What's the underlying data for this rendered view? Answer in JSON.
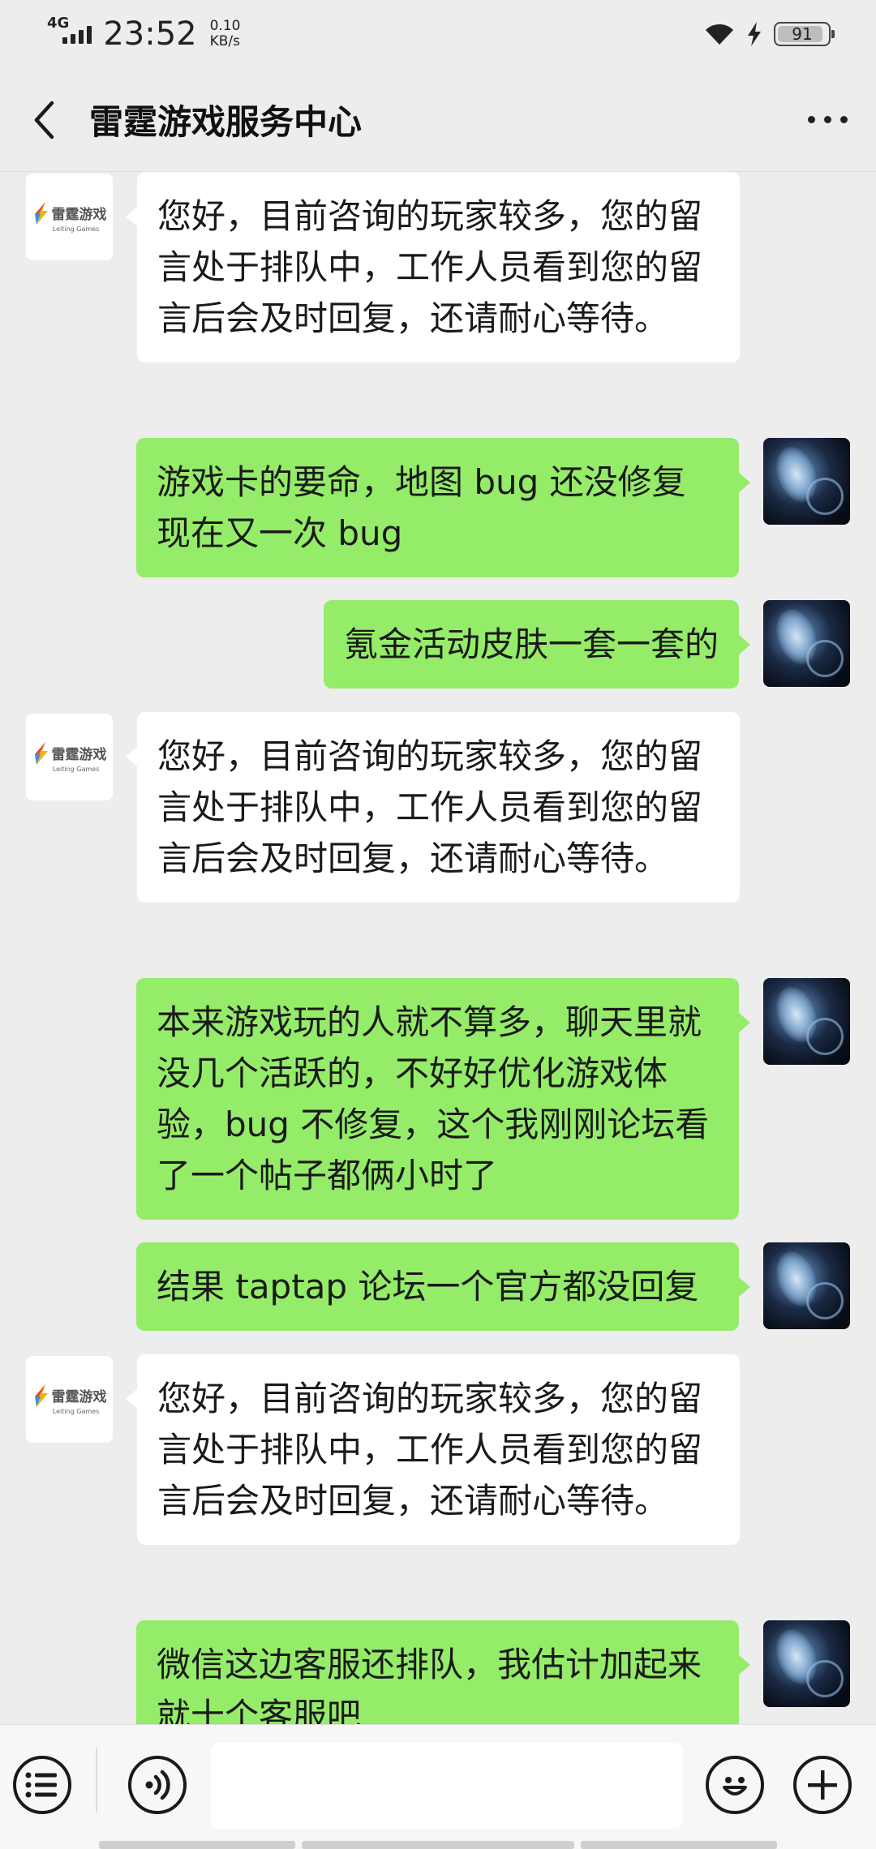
{
  "status_bar": {
    "network": "4G",
    "time": "23:52",
    "speed_value": "0.10",
    "speed_unit": "KB/s",
    "battery": "91",
    "battery_level": 0.91,
    "icons": [
      "signal-icon",
      "wifi-icon",
      "charging-icon",
      "battery-icon"
    ]
  },
  "header": {
    "title": "雷霆游戏服务中心",
    "back_icon": "chevron-left-icon",
    "more_icon": "more-icon"
  },
  "official_avatar": {
    "logo_text_zh": "雷霆游戏",
    "logo_text_en": "Leiting Games"
  },
  "messages": [
    {
      "from": "official",
      "text": "您好，目前咨询的玩家较多，您的留言处于排队中，工作人员看到您的留言后会及时回复，还请耐心等待。"
    },
    {
      "from": "me",
      "text": "游戏卡的要命，地图 bug 还没修复现在又一次 bug"
    },
    {
      "from": "me",
      "text": "氪金活动皮肤一套一套的"
    },
    {
      "from": "official",
      "text": "您好，目前咨询的玩家较多，您的留言处于排队中，工作人员看到您的留言后会及时回复，还请耐心等待。"
    },
    {
      "from": "me",
      "text": "本来游戏玩的人就不算多，聊天里就没几个活跃的，不好好优化游戏体验，bug 不修复，这个我刚刚论坛看了一个帖子都俩小时了"
    },
    {
      "from": "me",
      "text": "结果 taptap 论坛一个官方都没回复"
    },
    {
      "from": "official",
      "text": "您好，目前咨询的玩家较多，您的留言处于排队中，工作人员看到您的留言后会及时回复，还请耐心等待。"
    },
    {
      "from": "me",
      "text": "微信这边客服还排队，我估计加起来就十个客服吧"
    }
  ],
  "bottom_bar": {
    "menu_icon": "menu-list-icon",
    "voice_icon": "voice-icon",
    "input_value": "",
    "emoji_icon": "emoji-icon",
    "plus_icon": "plus-icon"
  },
  "colors": {
    "background": "#ededed",
    "bubble_me": "#95ec69",
    "bubble_official": "#ffffff"
  }
}
